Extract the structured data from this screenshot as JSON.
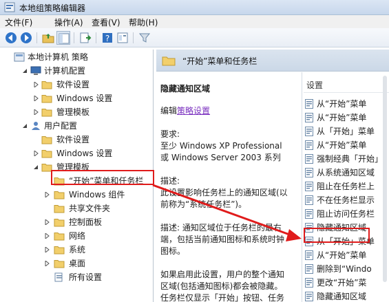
{
  "window": {
    "title": "本地组策略编辑器"
  },
  "menu": [
    {
      "label": "文件(F)"
    },
    {
      "label": "操作(A)"
    },
    {
      "label": "查看(V)"
    },
    {
      "label": "帮助(H)"
    }
  ],
  "toolbar": {
    "icons": [
      "back-arrow",
      "forward-arrow",
      "up-folder",
      "show-hide-tree",
      "export-list",
      "help",
      "properties",
      "filter"
    ]
  },
  "tree": {
    "root": "本地计算机 策略",
    "computer": "计算机配置",
    "computer_children": [
      "软件设置",
      "Windows 设置",
      "管理模板"
    ],
    "user": "用户配置",
    "user_children": [
      "软件设置",
      "Windows 设置",
      "管理模板"
    ],
    "selected": "“开始”菜单和任务栏",
    "admin_children": [
      "Windows 组件",
      "共享文件夹",
      "控制面板",
      "网络",
      "系统",
      "桌面",
      "所有设置"
    ]
  },
  "detail": {
    "header": "“开始”菜单和任务栏",
    "setting_title": "隐藏通知区域",
    "edit_prefix": "编辑",
    "edit_link": "策略设置",
    "req_label": "要求:",
    "req_line1": "至少 Windows XP Professional",
    "req_line2": "或 Windows Server 2003 系列",
    "desc_label": "描述:",
    "desc_line1": "此设置影响任务栏上的通知区域(以",
    "desc_line2": "前称为“系统任务栏”)。",
    "desc2_line1": "描述: 通知区域位于任务栏的最右",
    "desc2_line2": "端，包括当前通知图标和系统时钟",
    "desc2_line3": "图标。",
    "enable_line1": "如果启用此设置，用户的整个通知",
    "enable_line2": "区域(包括通知图标)都会被隐藏。",
    "enable_line3": "任务栏仅显示「开始」按钮、任务"
  },
  "list": {
    "column": "设置",
    "items": [
      "从“开始”菜单",
      "从“开始”菜单",
      "从「开始」菜单",
      "从“开始”菜单",
      "强制经典「开始」",
      "从系统通知区域",
      "阻止在任务栏上",
      "不在任务栏显示",
      "阻止访问任务栏",
      "隐藏通知区域",
      "从「开始」菜单",
      "从“开始”菜单",
      "删除到“Windo",
      "更改“开始”菜",
      "隐藏通知区域"
    ],
    "highlighted_index": 9
  },
  "colors": {
    "highlight": "#e01b1b",
    "link": "#7a2fbf"
  }
}
